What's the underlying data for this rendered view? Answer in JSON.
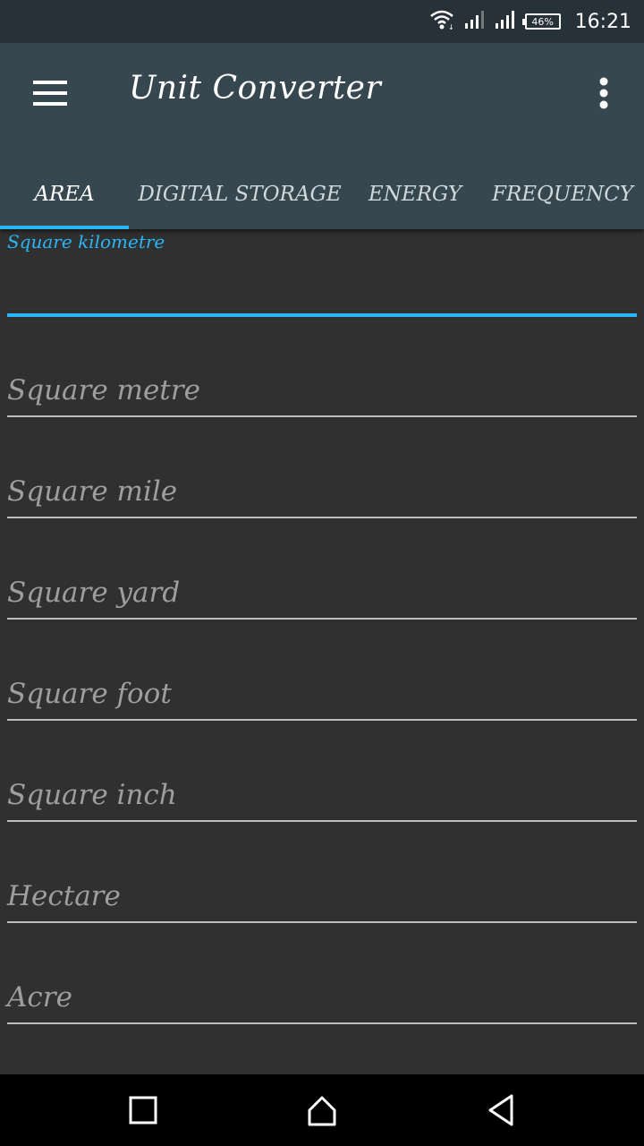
{
  "status_bar": {
    "time": "16:21",
    "battery_percent": "46%",
    "icons": [
      "wifi-icon",
      "signal-icon",
      "signal-icon",
      "battery-icon"
    ]
  },
  "app_bar": {
    "title": "Unit Converter",
    "menu_icon": "hamburger-menu-icon",
    "overflow_icon": "more-vert-icon"
  },
  "tabs": [
    {
      "label": "AREA",
      "active": true
    },
    {
      "label": "DIGITAL STORAGE",
      "active": false
    },
    {
      "label": "ENERGY",
      "active": false
    },
    {
      "label": "FREQUENCY",
      "active": false
    }
  ],
  "form": {
    "focused_field": {
      "label": "Square kilometre",
      "value": ""
    },
    "fields": [
      {
        "hint": "Square metre"
      },
      {
        "hint": "Square mile"
      },
      {
        "hint": "Square yard"
      },
      {
        "hint": "Square foot"
      },
      {
        "hint": "Square inch"
      },
      {
        "hint": "Hectare"
      },
      {
        "hint": "Acre"
      }
    ]
  },
  "nav_bar": {
    "icons": [
      "recents-icon",
      "home-icon",
      "back-icon"
    ]
  },
  "colors": {
    "status_bar": "#263238",
    "app_bar": "#37474f",
    "accent": "#29b6f6",
    "background": "#303030"
  }
}
